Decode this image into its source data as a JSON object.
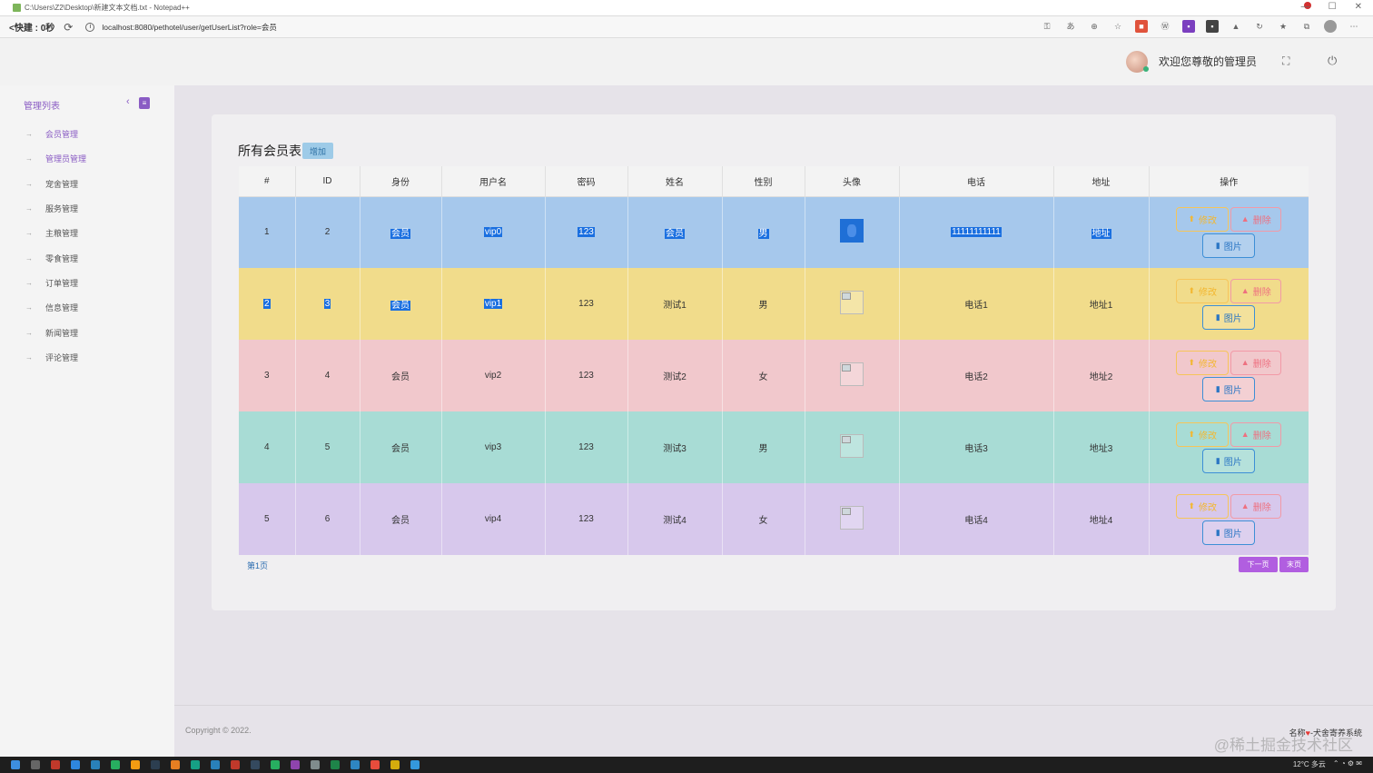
{
  "window": {
    "title": "C:\\Users\\Z2\\Desktop\\新建文本文档.txt - Notepad++"
  },
  "browser": {
    "nav_label": "<快建 : 0秒",
    "url": "localhost:8080/pethotel/user/getUserList?role=会员"
  },
  "header": {
    "welcome": "欢迎您尊敬的管理员"
  },
  "sidebar": {
    "title": "管理列表",
    "items": [
      {
        "label": "会员管理"
      },
      {
        "label": "管理员管理"
      },
      {
        "label": "宠舍管理"
      },
      {
        "label": "服务管理"
      },
      {
        "label": "主粮管理"
      },
      {
        "label": "零食管理"
      },
      {
        "label": "订单管理"
      },
      {
        "label": "信息管理"
      },
      {
        "label": "新闻管理"
      },
      {
        "label": "评论管理"
      }
    ]
  },
  "page": {
    "title": "所有会员表",
    "add_label": "增加"
  },
  "table": {
    "headers": [
      "#",
      "ID",
      "身份",
      "用户名",
      "密码",
      "姓名",
      "性别",
      "头像",
      "电话",
      "地址",
      "操作"
    ],
    "rows": [
      {
        "num": "1",
        "id": "2",
        "role": "会员",
        "username": "vip0",
        "password": "123",
        "name": "会员",
        "gender": "男",
        "phone": "11111111111",
        "address": "地址"
      },
      {
        "num": "2",
        "id": "3",
        "role": "会员",
        "username": "vip1",
        "password": "123",
        "name": "测试1",
        "gender": "男",
        "phone": "电话1",
        "address": "地址1"
      },
      {
        "num": "3",
        "id": "4",
        "role": "会员",
        "username": "vip2",
        "password": "123",
        "name": "测试2",
        "gender": "女",
        "phone": "电话2",
        "address": "地址2"
      },
      {
        "num": "4",
        "id": "5",
        "role": "会员",
        "username": "vip3",
        "password": "123",
        "name": "测试3",
        "gender": "男",
        "phone": "电话3",
        "address": "地址3"
      },
      {
        "num": "5",
        "id": "6",
        "role": "会员",
        "username": "vip4",
        "password": "123",
        "name": "测试4",
        "gender": "女",
        "phone": "电话4",
        "address": "地址4"
      }
    ],
    "actions": {
      "edit": "修改",
      "delete": "删除",
      "image": "图片"
    }
  },
  "pagination": {
    "page_label": "第1页",
    "next": "下一页",
    "last": "末页"
  },
  "footer": {
    "copyright": "Copyright © 2022.",
    "system_name_prefix": "名称",
    "system_name_suffix": "-犬舍寄养系统",
    "watermark": "@稀土掘金技术社区"
  },
  "taskbar": {
    "weather": "12°C 多云"
  },
  "colors": {
    "accent": "#8a5cc4",
    "row_colors": [
      "#a6c8ec",
      "#f1dc8b",
      "#f1c8cc",
      "#a8dcd5",
      "#d7c8ec"
    ],
    "edit": "#f3b730",
    "delete": "#ee7080",
    "image": "#2b76c4",
    "pager": "#b15ee0"
  }
}
